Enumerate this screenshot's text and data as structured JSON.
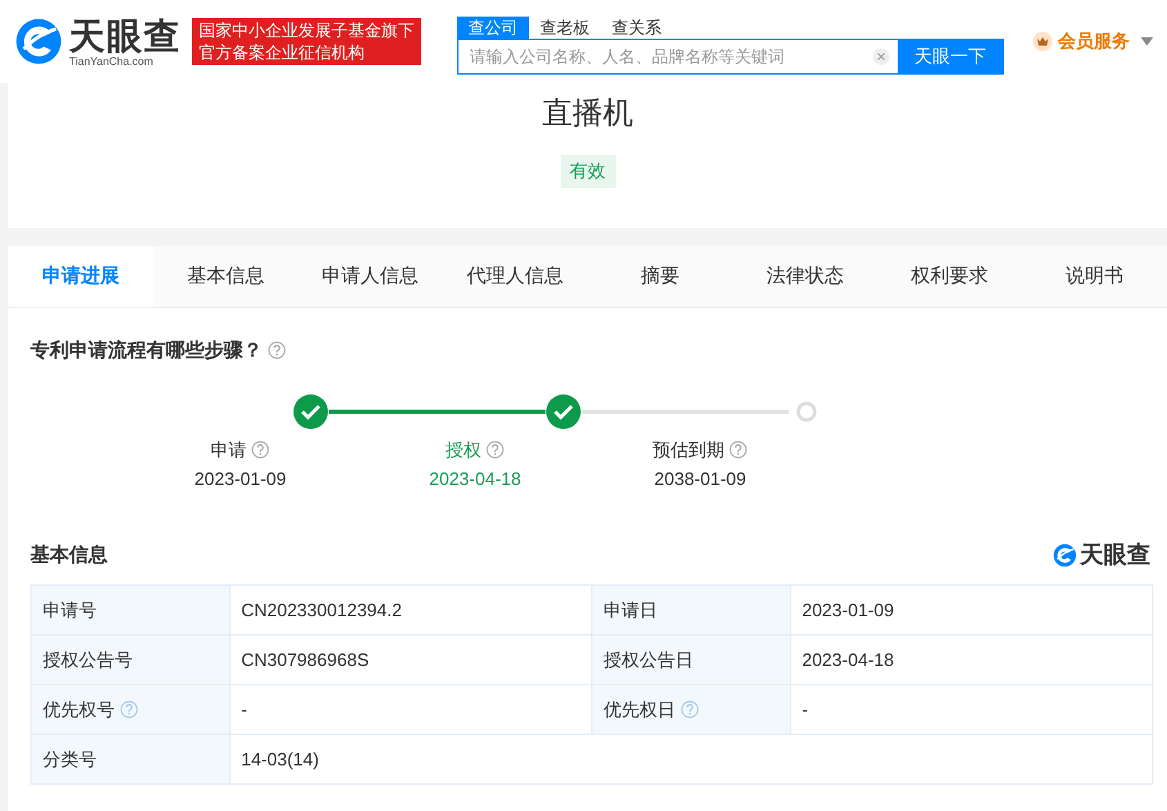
{
  "header": {
    "logo": {
      "name": "天眼查",
      "domain": "TianYanCha.com"
    },
    "banner": [
      "国家中小企业发展子基金旗下",
      "官方备案企业征信机构"
    ],
    "search_tabs": [
      {
        "label": "查公司",
        "selected": true
      },
      {
        "label": "查老板",
        "selected": false
      },
      {
        "label": "查关系",
        "selected": false
      }
    ],
    "search": {
      "placeholder": "请输入公司名称、人名、品牌名称等关键词",
      "clear": "×",
      "button": "天眼一下"
    },
    "member": "会员服务"
  },
  "summary": {
    "title": "直播机",
    "status": "有效"
  },
  "tabs": [
    {
      "label": "申请进展",
      "selected": true
    },
    {
      "label": "基本信息",
      "selected": false
    },
    {
      "label": "申请人信息",
      "selected": false
    },
    {
      "label": "代理人信息",
      "selected": false
    },
    {
      "label": "摘要",
      "selected": false
    },
    {
      "label": "法律状态",
      "selected": false
    },
    {
      "label": "权利要求",
      "selected": false
    },
    {
      "label": "说明书",
      "selected": false
    }
  ],
  "progress": {
    "heading": "专利申请流程有哪些步骤？",
    "steps": [
      {
        "label": "申请",
        "date": "2023-01-09",
        "done": true,
        "selected": false
      },
      {
        "label": "授权",
        "date": "2023-04-18",
        "done": true,
        "selected": true
      },
      {
        "label": "预估到期",
        "date": "2038-01-09",
        "done": false,
        "selected": false
      }
    ]
  },
  "basic_info": {
    "heading": "基本信息",
    "brand": "天眼查",
    "rows": [
      [
        {
          "label": "申请号",
          "value": "CN202330012394.2",
          "help": false
        },
        {
          "label": "申请日",
          "value": "2023-01-09",
          "help": false
        }
      ],
      [
        {
          "label": "授权公告号",
          "value": "CN307986968S",
          "help": false
        },
        {
          "label": "授权公告日",
          "value": "2023-04-18",
          "help": false
        }
      ],
      [
        {
          "label": "优先权号",
          "value": "-",
          "help": true
        },
        {
          "label": "优先权日",
          "value": "-",
          "help": true
        }
      ],
      [
        {
          "label": "分类号",
          "value": "14-03(14)",
          "help": false
        }
      ]
    ]
  }
}
